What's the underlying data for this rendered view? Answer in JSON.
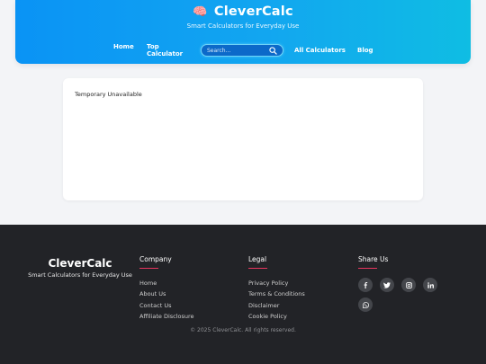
{
  "header": {
    "brand_icon": "🧠",
    "brand_title": "CleverCalc",
    "tagline": "Smart Calculators for Everyday Use",
    "nav": {
      "home": "Home",
      "top_calculator": "Top Calculator",
      "all_calculators": "All Calculators",
      "blog": "Blog"
    },
    "search": {
      "placeholder": "Search...",
      "icon": "search-icon"
    }
  },
  "main": {
    "message": "Temporary Unavailable"
  },
  "footer": {
    "brand_title": "CleverCalc",
    "brand_tagline": "Smart Calculators for Everyday Use",
    "company": {
      "heading": "Company",
      "links": [
        "Home",
        "About Us",
        "Contact Us",
        "Affiliate Disclosure"
      ]
    },
    "legal": {
      "heading": "Legal",
      "links": [
        "Privacy Policy",
        "Terms & Conditions",
        "Disclaimer",
        "Cookie Policy"
      ]
    },
    "share": {
      "heading": "Share Us",
      "icons": [
        "facebook-icon",
        "twitter-icon",
        "instagram-icon",
        "linkedin-icon",
        "whatsapp-icon"
      ]
    },
    "copyright": "© 2025 CleverCalc. All rights reserved."
  },
  "colors": {
    "header_gradient_start": "#0a93f5",
    "header_gradient_end": "#0fbde3",
    "footer_bg": "#222327",
    "accent_underline": "#e8355e"
  }
}
